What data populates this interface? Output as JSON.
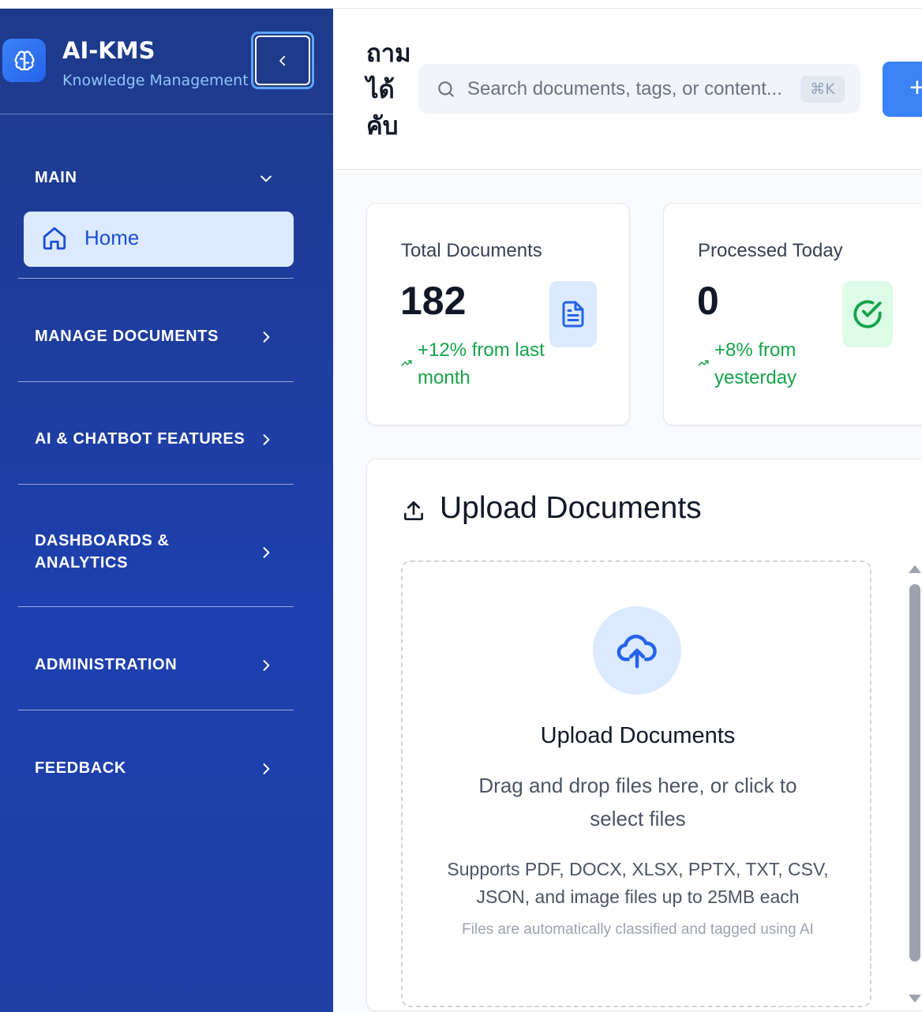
{
  "brand": {
    "title": "AI-KMS",
    "subtitle": "Knowledge Management"
  },
  "sidebar": {
    "main_section": "MAIN",
    "home_label": "Home",
    "sections": [
      {
        "label": "MANAGE DOCUMENTS"
      },
      {
        "label": "AI & CHATBOT FEATURES"
      },
      {
        "label": "DASHBOARDS & ANALYTICS"
      },
      {
        "label": "ADMINISTRATION"
      },
      {
        "label": "FEEDBACK"
      }
    ]
  },
  "header": {
    "page_title": "ถามได้คับ",
    "search_placeholder": "Search documents, tags, or content...",
    "search_shortcut": "⌘K",
    "add_button_label": "+"
  },
  "stats": [
    {
      "label": "Total Documents",
      "value": "182",
      "trend": "+12% from last month",
      "icon": "document-icon",
      "color": "#dbeafe",
      "icon_color": "#2563eb"
    },
    {
      "label": "Processed Today",
      "value": "0",
      "trend": "+8% from yesterday",
      "icon": "check-circle-icon",
      "color": "#dcfce7",
      "icon_color": "#16a34a"
    }
  ],
  "upload": {
    "heading": "Upload Documents",
    "dropzone_title": "Upload Documents",
    "dropzone_desc": "Drag and drop files here, or click to select files",
    "supported": "Supports PDF, DOCX, XLSX, PPTX, TXT, CSV, JSON, and image files up to 25MB each",
    "note": "Files are automatically classified and tagged using AI"
  },
  "colors": {
    "sidebar_bg": "#1e40af",
    "accent": "#3b82f6",
    "trend_green": "#16a34a"
  }
}
